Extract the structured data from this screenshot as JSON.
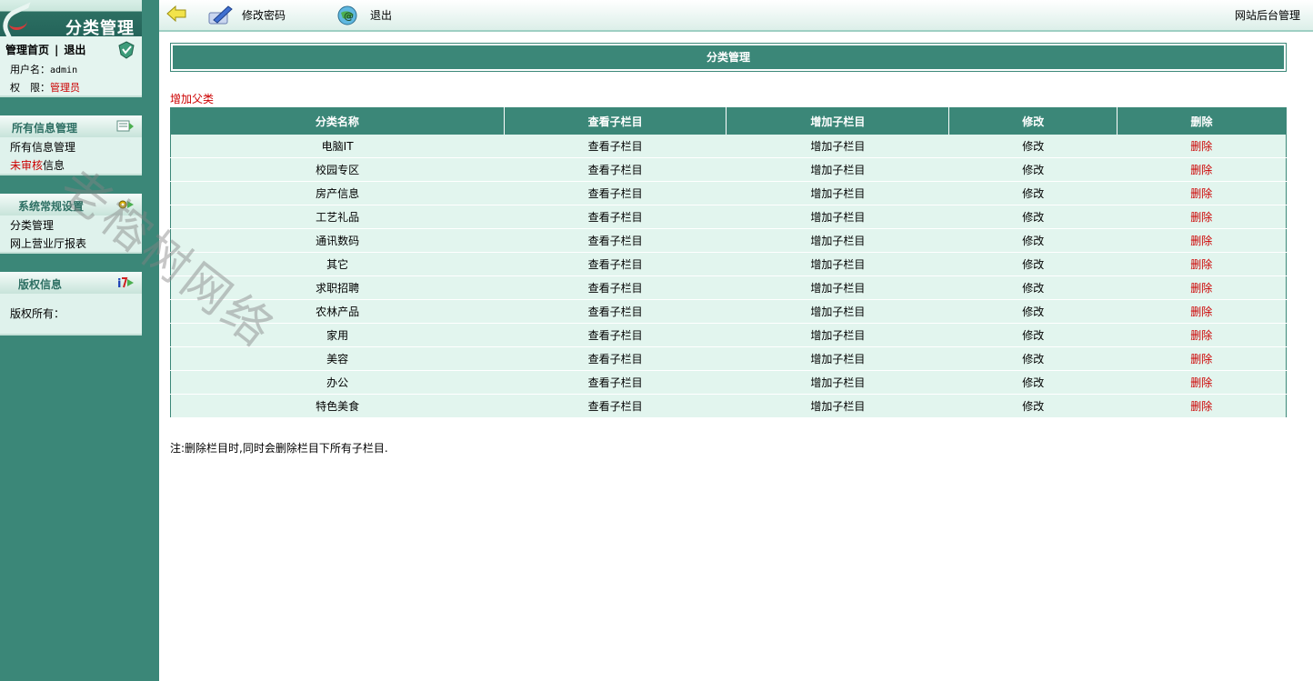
{
  "sidebar": {
    "logo_title": "分类管理",
    "top_links": {
      "home": "管理首页",
      "separator": "|",
      "logout": "退出"
    },
    "user": {
      "username_label": "用户名：",
      "username": "admin",
      "role_label": "权　限：",
      "role": "管理员"
    },
    "panels": {
      "info": {
        "title": "所有信息管理",
        "items": [
          {
            "label": "所有信息管理"
          },
          {
            "prefix": "未审核",
            "label": "信息"
          }
        ]
      },
      "sys": {
        "title": "系统常规设置",
        "items": [
          {
            "label": "分类管理"
          },
          {
            "label": "网上营业厅报表"
          }
        ]
      },
      "copy": {
        "title": "版权信息",
        "text": "版权所有："
      }
    }
  },
  "topbar": {
    "change_password": "修改密码",
    "logout": "退出",
    "site_admin": "网站后台管理"
  },
  "main": {
    "title": "分类管理",
    "add_parent": "增加父类",
    "table": {
      "headers": [
        "分类名称",
        "查看子栏目",
        "增加子栏目",
        "修改",
        "删除"
      ],
      "rows": [
        {
          "name": "电脑IT",
          "view": "查看子栏目",
          "add": "增加子栏目",
          "edit": "修改",
          "del": "删除"
        },
        {
          "name": "校园专区",
          "view": "查看子栏目",
          "add": "增加子栏目",
          "edit": "修改",
          "del": "删除"
        },
        {
          "name": "房产信息",
          "view": "查看子栏目",
          "add": "增加子栏目",
          "edit": "修改",
          "del": "删除"
        },
        {
          "name": "工艺礼品",
          "view": "查看子栏目",
          "add": "增加子栏目",
          "edit": "修改",
          "del": "删除"
        },
        {
          "name": "通讯数码",
          "view": "查看子栏目",
          "add": "增加子栏目",
          "edit": "修改",
          "del": "删除"
        },
        {
          "name": "其它",
          "view": "查看子栏目",
          "add": "增加子栏目",
          "edit": "修改",
          "del": "删除"
        },
        {
          "name": "求职招聘",
          "view": "查看子栏目",
          "add": "增加子栏目",
          "edit": "修改",
          "del": "删除"
        },
        {
          "name": "农林产品",
          "view": "查看子栏目",
          "add": "增加子栏目",
          "edit": "修改",
          "del": "删除"
        },
        {
          "name": "家用",
          "view": "查看子栏目",
          "add": "增加子栏目",
          "edit": "修改",
          "del": "删除"
        },
        {
          "name": "美容",
          "view": "查看子栏目",
          "add": "增加子栏目",
          "edit": "修改",
          "del": "删除"
        },
        {
          "name": "办公",
          "view": "查看子栏目",
          "add": "增加子栏目",
          "edit": "修改",
          "del": "删除"
        },
        {
          "name": "特色美食",
          "view": "查看子栏目",
          "add": "增加子栏目",
          "edit": "修改",
          "del": "删除"
        }
      ]
    },
    "note": "注:删除栏目时,同时会删除栏目下所有子栏目."
  },
  "watermark": "老榕树网络",
  "icons": {
    "back": "arrow-left-icon",
    "change_password": "pen-icon",
    "logout": "globe-icon",
    "user_panel": "shield-icon",
    "info_panel": "document-icon",
    "sys_panel": "gear-icon",
    "copy_panel": "info-icon"
  },
  "colors": {
    "sidebar": "#3b8778",
    "header": "#3b8778",
    "row": "#e2f5ee",
    "alert": "#cc0000"
  }
}
